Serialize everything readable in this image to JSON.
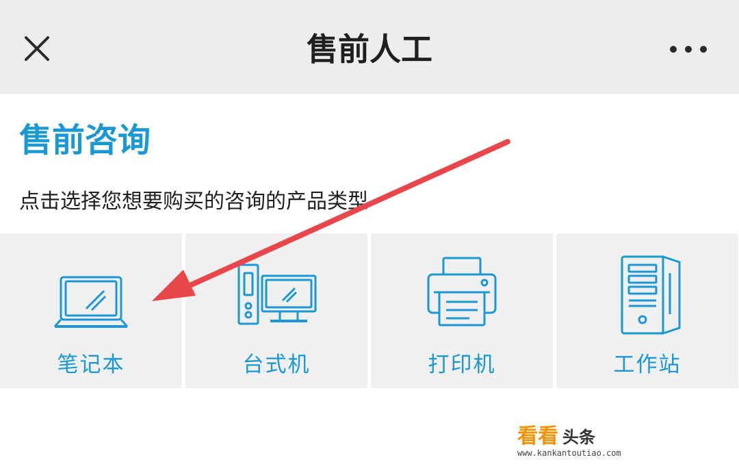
{
  "header": {
    "title": "售前人工",
    "close_icon": "close-icon",
    "more_icon": "more-dots-icon"
  },
  "main": {
    "section_title": "售前咨询",
    "subtitle": "点击选择您想要购买的咨询的产品类型",
    "products": [
      {
        "label": "笔记本",
        "icon": "laptop-icon"
      },
      {
        "label": "台式机",
        "icon": "desktop-icon"
      },
      {
        "label": "打印机",
        "icon": "printer-icon"
      },
      {
        "label": "工作站",
        "icon": "workstation-icon"
      }
    ]
  },
  "annotation": {
    "arrow_color": "#e8464a",
    "arrow_target": "笔记本"
  },
  "watermark": {
    "brand_part1": "看看",
    "brand_part2": "头条",
    "url": "www.kankantoutiao.com"
  },
  "colors": {
    "accent": "#1a98d3",
    "header_bg": "#ededed",
    "tile_bg": "#f0f0f0"
  }
}
